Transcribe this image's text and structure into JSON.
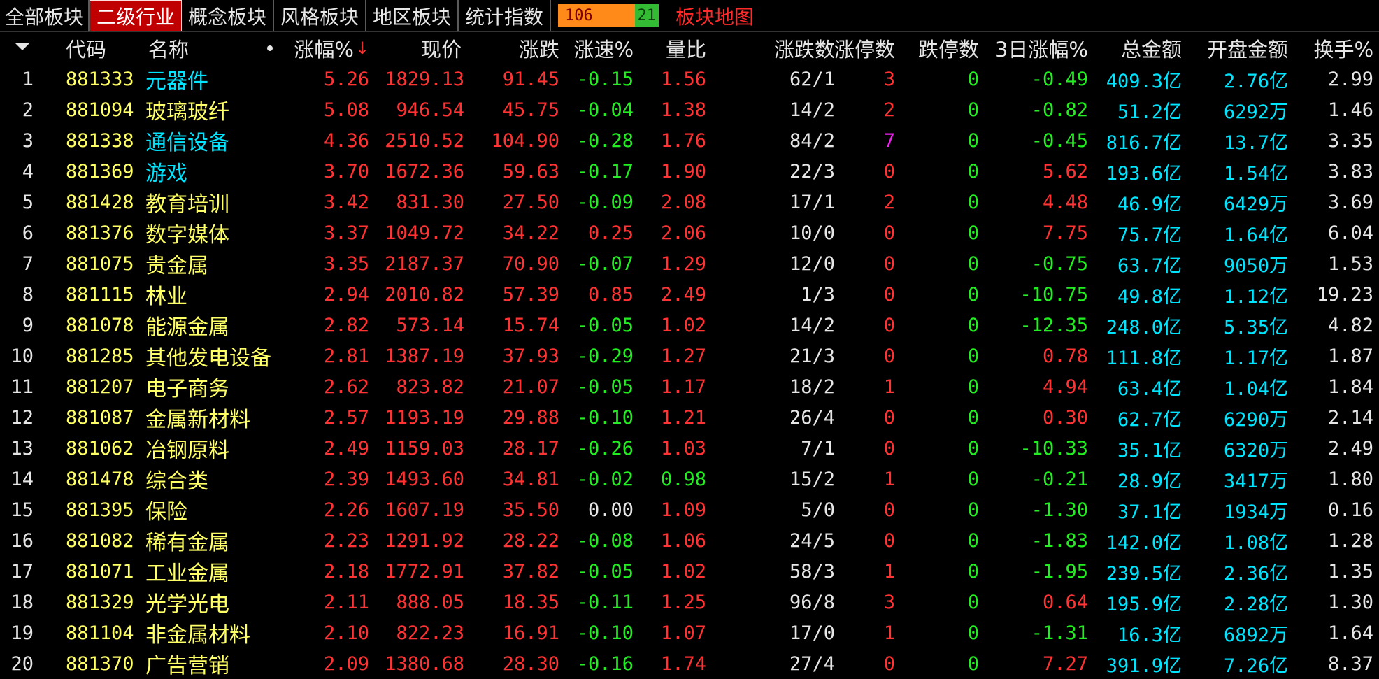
{
  "tabs": [
    "全部板块",
    "二级行业",
    "概念板块",
    "风格板块",
    "地区板块",
    "统计指数"
  ],
  "active_tab": 1,
  "updown": {
    "up": "106",
    "down": "21"
  },
  "map_label": "板块地图",
  "headers": {
    "code": "代码",
    "name": "名称",
    "chg": "涨幅%",
    "price": "现价",
    "change": "涨跌",
    "speed": "涨速%",
    "volratio": "量比",
    "adv": "涨跌数",
    "limitup": "涨停数",
    "limitdown": "跌停数",
    "chg3d": "3日涨幅%",
    "amount": "总金额",
    "openamt": "开盘金额",
    "turnover": "换手%"
  },
  "colors": {
    "up": "#ff3333",
    "down": "#22ee22",
    "flat": "#e6e6e6",
    "code": "#ffff66",
    "amount": "#00e5ff",
    "limit_high": "#ee22ee"
  },
  "rows": [
    {
      "idx": "1",
      "code": "881333",
      "name": "元器件",
      "name_color": "cyan",
      "chg": "5.26",
      "price": "1829.13",
      "change": "91.45",
      "speed": "-0.15",
      "volratio": "1.56",
      "adv": "62/1",
      "limitup": "3",
      "limitdown": "0",
      "chg3d": "-0.49",
      "amount": "409.3亿",
      "openamt": "2.76亿",
      "turnover": "2.99"
    },
    {
      "idx": "2",
      "code": "881094",
      "name": "玻璃玻纤",
      "name_color": "yellow",
      "chg": "5.08",
      "price": "946.54",
      "change": "45.75",
      "speed": "-0.04",
      "volratio": "1.38",
      "adv": "14/2",
      "limitup": "2",
      "limitdown": "0",
      "chg3d": "-0.82",
      "amount": "51.2亿",
      "openamt": "6292万",
      "turnover": "1.46"
    },
    {
      "idx": "3",
      "code": "881338",
      "name": "通信设备",
      "name_color": "cyan",
      "chg": "4.36",
      "price": "2510.52",
      "change": "104.90",
      "speed": "-0.28",
      "volratio": "1.76",
      "adv": "84/2",
      "limitup": "7",
      "limitdown": "0",
      "chg3d": "-0.45",
      "amount": "816.7亿",
      "openamt": "13.7亿",
      "turnover": "3.35"
    },
    {
      "idx": "4",
      "code": "881369",
      "name": "游戏",
      "name_color": "cyan",
      "chg": "3.70",
      "price": "1672.36",
      "change": "59.63",
      "speed": "-0.17",
      "volratio": "1.90",
      "adv": "22/3",
      "limitup": "0",
      "limitdown": "0",
      "chg3d": "5.62",
      "amount": "193.6亿",
      "openamt": "1.54亿",
      "turnover": "3.83"
    },
    {
      "idx": "5",
      "code": "881428",
      "name": "教育培训",
      "name_color": "yellow",
      "chg": "3.42",
      "price": "831.30",
      "change": "27.50",
      "speed": "-0.09",
      "volratio": "2.08",
      "adv": "17/1",
      "limitup": "2",
      "limitdown": "0",
      "chg3d": "4.48",
      "amount": "46.9亿",
      "openamt": "6429万",
      "turnover": "3.69"
    },
    {
      "idx": "6",
      "code": "881376",
      "name": "数字媒体",
      "name_color": "yellow",
      "chg": "3.37",
      "price": "1049.72",
      "change": "34.22",
      "speed": "0.25",
      "volratio": "2.06",
      "adv": "10/0",
      "limitup": "0",
      "limitdown": "0",
      "chg3d": "7.75",
      "amount": "75.7亿",
      "openamt": "1.64亿",
      "turnover": "6.04"
    },
    {
      "idx": "7",
      "code": "881075",
      "name": "贵金属",
      "name_color": "yellow",
      "chg": "3.35",
      "price": "2187.37",
      "change": "70.90",
      "speed": "-0.07",
      "volratio": "1.29",
      "adv": "12/0",
      "limitup": "0",
      "limitdown": "0",
      "chg3d": "-0.75",
      "amount": "63.7亿",
      "openamt": "9050万",
      "turnover": "1.53"
    },
    {
      "idx": "8",
      "code": "881115",
      "name": "林业",
      "name_color": "yellow",
      "chg": "2.94",
      "price": "2010.82",
      "change": "57.39",
      "speed": "0.85",
      "volratio": "2.49",
      "adv": "1/3",
      "limitup": "0",
      "limitdown": "0",
      "chg3d": "-10.75",
      "amount": "49.8亿",
      "openamt": "1.12亿",
      "turnover": "19.23"
    },
    {
      "idx": "9",
      "code": "881078",
      "name": "能源金属",
      "name_color": "yellow",
      "chg": "2.82",
      "price": "573.14",
      "change": "15.74",
      "speed": "-0.05",
      "volratio": "1.02",
      "adv": "14/2",
      "limitup": "0",
      "limitdown": "0",
      "chg3d": "-12.35",
      "amount": "248.0亿",
      "openamt": "5.35亿",
      "turnover": "4.82"
    },
    {
      "idx": "10",
      "code": "881285",
      "name": "其他发电设备",
      "name_color": "yellow",
      "chg": "2.81",
      "price": "1387.19",
      "change": "37.93",
      "speed": "-0.29",
      "volratio": "1.27",
      "adv": "21/3",
      "limitup": "0",
      "limitdown": "0",
      "chg3d": "0.78",
      "amount": "111.8亿",
      "openamt": "1.17亿",
      "turnover": "1.87"
    },
    {
      "idx": "11",
      "code": "881207",
      "name": "电子商务",
      "name_color": "yellow",
      "chg": "2.62",
      "price": "823.82",
      "change": "21.07",
      "speed": "-0.05",
      "volratio": "1.17",
      "adv": "18/2",
      "limitup": "1",
      "limitdown": "0",
      "chg3d": "4.94",
      "amount": "63.4亿",
      "openamt": "1.04亿",
      "turnover": "1.84"
    },
    {
      "idx": "12",
      "code": "881087",
      "name": "金属新材料",
      "name_color": "yellow",
      "chg": "2.57",
      "price": "1193.19",
      "change": "29.88",
      "speed": "-0.10",
      "volratio": "1.21",
      "adv": "26/4",
      "limitup": "0",
      "limitdown": "0",
      "chg3d": "0.30",
      "amount": "62.7亿",
      "openamt": "6290万",
      "turnover": "2.14"
    },
    {
      "idx": "13",
      "code": "881062",
      "name": "冶钢原料",
      "name_color": "yellow",
      "chg": "2.49",
      "price": "1159.03",
      "change": "28.17",
      "speed": "-0.26",
      "volratio": "1.03",
      "adv": "7/1",
      "limitup": "0",
      "limitdown": "0",
      "chg3d": "-10.33",
      "amount": "35.1亿",
      "openamt": "6320万",
      "turnover": "2.49"
    },
    {
      "idx": "14",
      "code": "881478",
      "name": "综合类",
      "name_color": "yellow",
      "chg": "2.39",
      "price": "1493.60",
      "change": "34.81",
      "speed": "-0.02",
      "volratio": "0.98",
      "adv": "15/2",
      "limitup": "1",
      "limitdown": "0",
      "chg3d": "-0.21",
      "amount": "28.9亿",
      "openamt": "3417万",
      "turnover": "1.80"
    },
    {
      "idx": "15",
      "code": "881395",
      "name": "保险",
      "name_color": "yellow",
      "chg": "2.26",
      "price": "1607.19",
      "change": "35.50",
      "speed": "0.00",
      "volratio": "1.09",
      "adv": "5/0",
      "limitup": "0",
      "limitdown": "0",
      "chg3d": "-1.30",
      "amount": "37.1亿",
      "openamt": "1934万",
      "turnover": "0.16"
    },
    {
      "idx": "16",
      "code": "881082",
      "name": "稀有金属",
      "name_color": "yellow",
      "chg": "2.23",
      "price": "1291.92",
      "change": "28.22",
      "speed": "-0.08",
      "volratio": "1.06",
      "adv": "24/5",
      "limitup": "0",
      "limitdown": "0",
      "chg3d": "-1.83",
      "amount": "142.0亿",
      "openamt": "1.08亿",
      "turnover": "1.28"
    },
    {
      "idx": "17",
      "code": "881071",
      "name": "工业金属",
      "name_color": "yellow",
      "chg": "2.18",
      "price": "1772.91",
      "change": "37.82",
      "speed": "-0.05",
      "volratio": "1.02",
      "adv": "58/3",
      "limitup": "1",
      "limitdown": "0",
      "chg3d": "-1.95",
      "amount": "239.5亿",
      "openamt": "2.36亿",
      "turnover": "1.35"
    },
    {
      "idx": "18",
      "code": "881329",
      "name": "光学光电",
      "name_color": "yellow",
      "chg": "2.11",
      "price": "888.05",
      "change": "18.35",
      "speed": "-0.11",
      "volratio": "1.25",
      "adv": "96/8",
      "limitup": "3",
      "limitdown": "0",
      "chg3d": "0.64",
      "amount": "195.9亿",
      "openamt": "2.28亿",
      "turnover": "1.30"
    },
    {
      "idx": "19",
      "code": "881104",
      "name": "非金属材料",
      "name_color": "yellow",
      "chg": "2.10",
      "price": "822.23",
      "change": "16.91",
      "speed": "-0.10",
      "volratio": "1.07",
      "adv": "17/0",
      "limitup": "1",
      "limitdown": "0",
      "chg3d": "-1.31",
      "amount": "16.3亿",
      "openamt": "6892万",
      "turnover": "1.64"
    },
    {
      "idx": "20",
      "code": "881370",
      "name": "广告营销",
      "name_color": "yellow",
      "chg": "2.09",
      "price": "1380.68",
      "change": "28.30",
      "speed": "-0.16",
      "volratio": "1.74",
      "adv": "27/4",
      "limitup": "0",
      "limitdown": "0",
      "chg3d": "7.27",
      "amount": "391.9亿",
      "openamt": "7.26亿",
      "turnover": "8.37"
    }
  ]
}
